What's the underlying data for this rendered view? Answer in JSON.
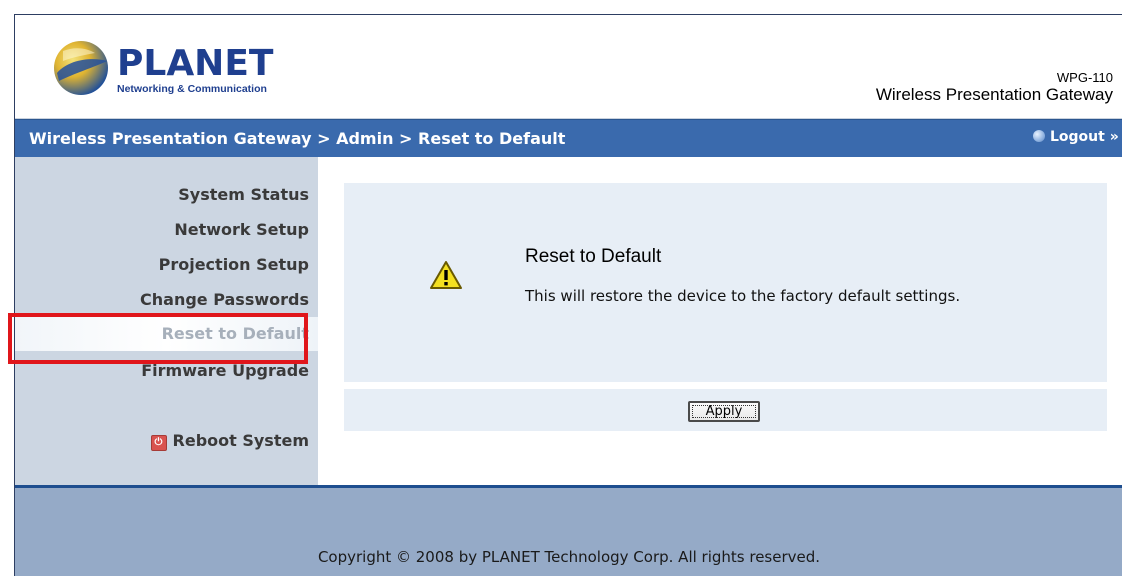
{
  "header": {
    "logo_text": "PLANET",
    "logo_tagline": "Networking & Communication",
    "model": "WPG-110",
    "product_name": "Wireless Presentation Gateway"
  },
  "titlebar": {
    "breadcrumb": "Wireless Presentation Gateway > Admin > Reset to Default",
    "logout_label": "Logout",
    "logout_icon": "globe-icon"
  },
  "sidebar": {
    "items": [
      {
        "label": "System Status"
      },
      {
        "label": "Network Setup"
      },
      {
        "label": "Projection Setup"
      },
      {
        "label": "Change Passwords"
      },
      {
        "label": "Reset to Default",
        "active": true
      },
      {
        "label": "Firmware Upgrade"
      }
    ],
    "reboot_label": "Reboot System",
    "reboot_icon": "power-icon"
  },
  "main": {
    "title": "Reset to Default",
    "description": "This will restore the device to the factory default settings.",
    "warning_icon": "warning-icon",
    "apply_label": "Apply"
  },
  "footer": {
    "copyright": "Copyright © 2008 by PLANET Technology Corp. All rights reserved."
  },
  "colors": {
    "titlebar": "#3a6aad",
    "sidebar": "#ccd6e2",
    "footer": "#95aac7",
    "highlight": "#e0161b",
    "content_panel": "#e7eef6"
  }
}
